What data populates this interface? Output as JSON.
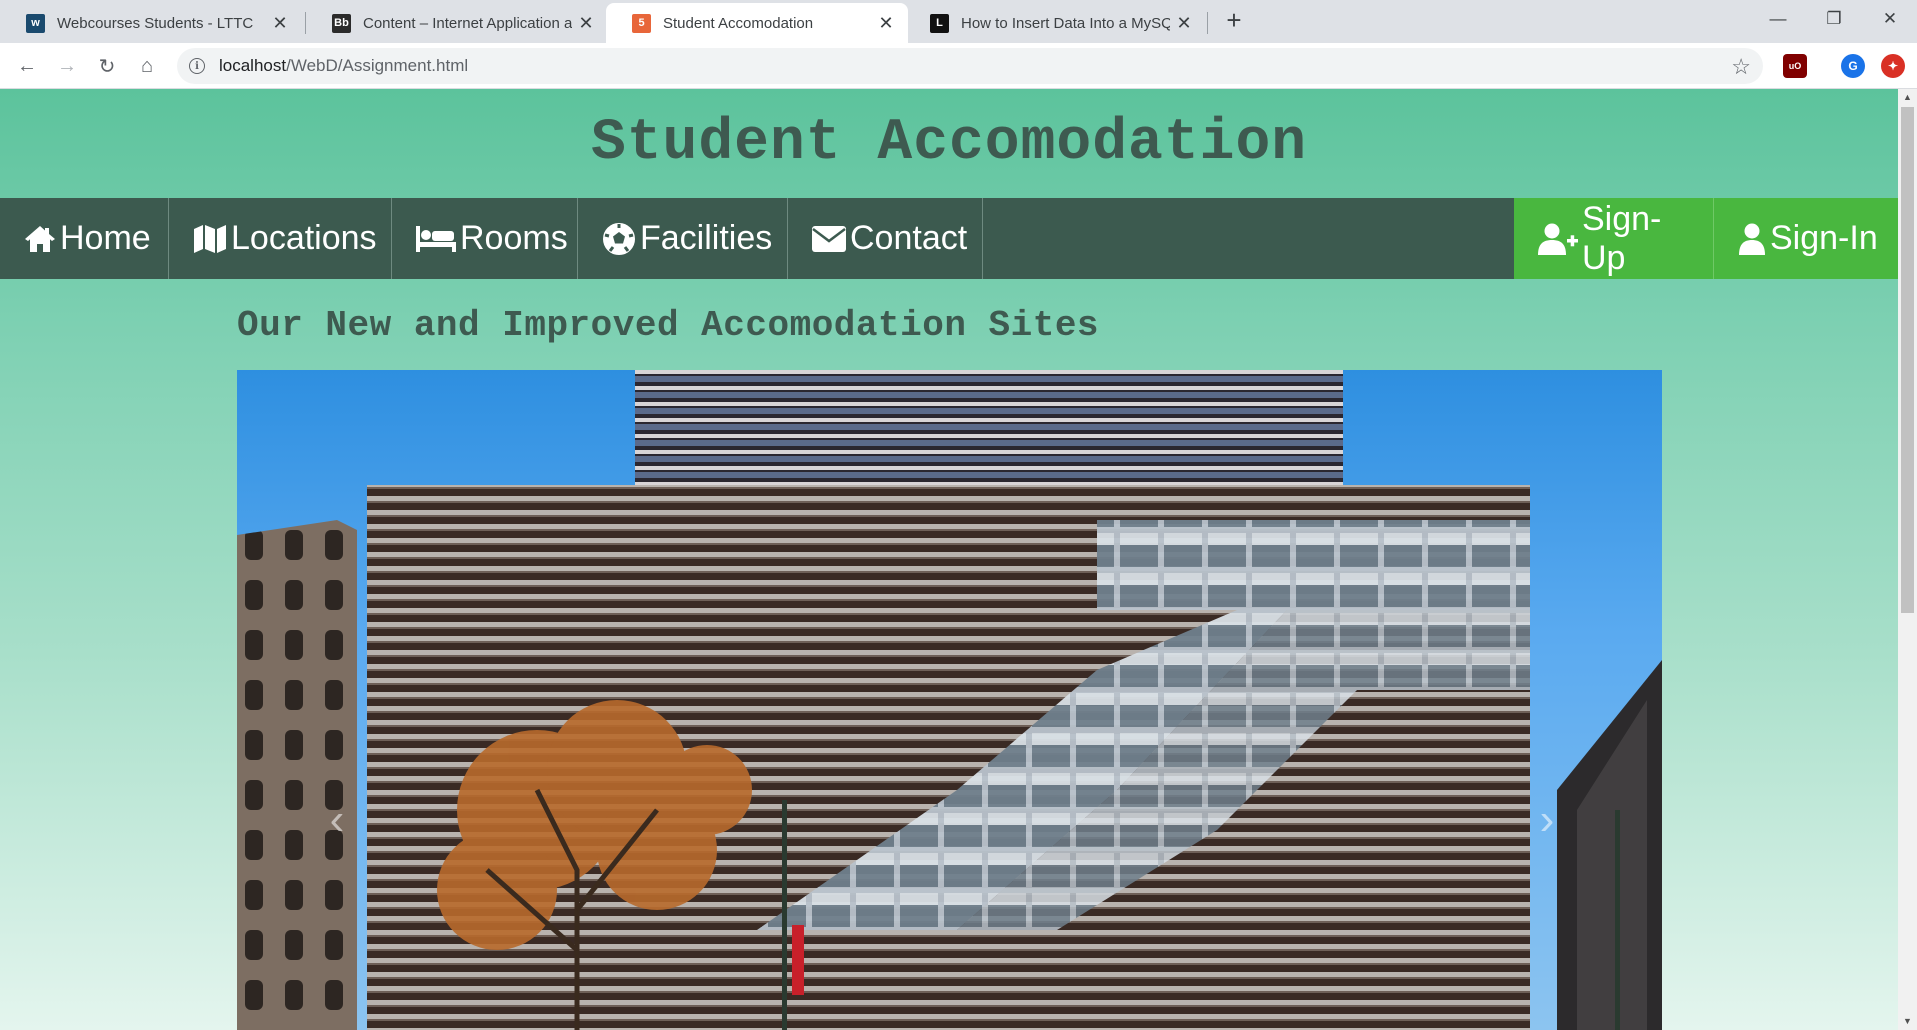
{
  "browser": {
    "tabs": [
      {
        "title": "Webcourses Students - LTTC",
        "icon": "webcourses-icon",
        "color": "#1a4a6e"
      },
      {
        "title": "Content – Internet Application ar",
        "icon": "blackboard-icon",
        "color": "#2b2b2b"
      },
      {
        "title": "Student Accomodation",
        "icon": "html-file-icon",
        "color": "#e8663a"
      },
      {
        "title": "How to Insert Data Into a MySQL",
        "icon": "l-icon",
        "color": "#111111"
      }
    ],
    "active_tab": 2,
    "url_host": "localhost",
    "url_path": "/WebD/Assignment.html",
    "profile_initial": "G",
    "extension_badge": "uO"
  },
  "page": {
    "title": "Student Accomodation",
    "nav_left": [
      {
        "label": "Home",
        "icon": "home-icon"
      },
      {
        "label": "Locations",
        "icon": "map-icon"
      },
      {
        "label": "Rooms",
        "icon": "bed-icon"
      },
      {
        "label": "Facilities",
        "icon": "soccer-ball-icon"
      },
      {
        "label": "Contact",
        "icon": "envelope-icon"
      }
    ],
    "nav_right": [
      {
        "label": "Sign-Up",
        "icon": "user-plus-icon"
      },
      {
        "label": "Sign-In",
        "icon": "user-icon"
      }
    ],
    "section_heading": "Our New and Improved Accomodation Sites",
    "carousel": {
      "image": "modern-building-photo",
      "prev_icon": "chevron-left-icon",
      "next_icon": "chevron-right-icon"
    }
  },
  "colors": {
    "header_bg": "#5cc39c",
    "nav_bg": "#3c5a4f",
    "nav_accent": "#49b73f",
    "title_text": "#3e5a50"
  }
}
